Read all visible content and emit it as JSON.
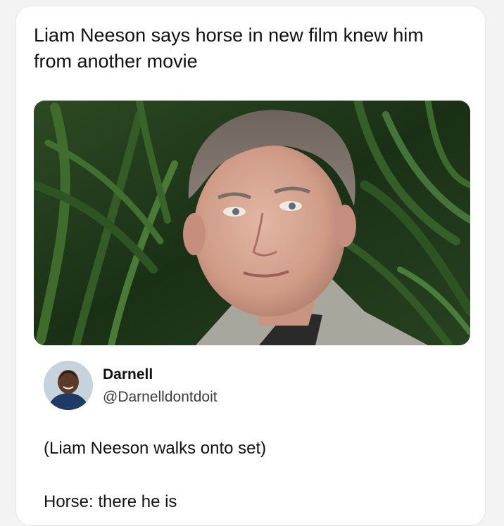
{
  "post": {
    "headline": "Liam Neeson says horse in new film knew him from another movie",
    "photo_icon": "photo-of-man-in-front-of-palm-leaves"
  },
  "reply": {
    "author_name": "Darnell",
    "author_handle": "@Darnelldontdoit",
    "line1": "(Liam Neeson walks onto set)",
    "line2": "Horse: there he is"
  },
  "colors": {
    "card_bg": "#ffffff",
    "page_bg": "#f3f3f3",
    "text": "#111111",
    "handle": "#3c3c3c"
  }
}
